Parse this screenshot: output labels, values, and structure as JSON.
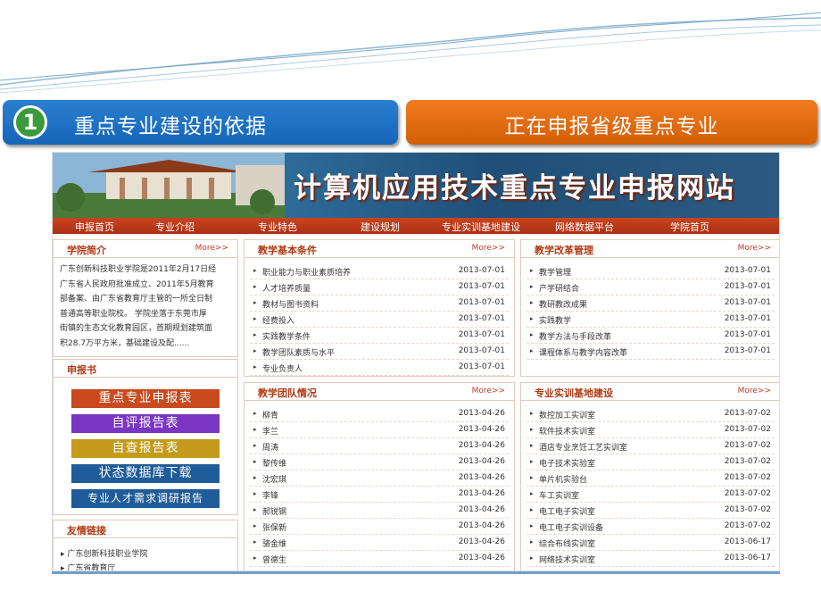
{
  "banner": {
    "num": "1",
    "left": "重点专业建设的依据",
    "right": "正在申报省级重点专业"
  },
  "site": {
    "title": "计算机应用技术重点专业申报网站",
    "nav": [
      "申报首页",
      "专业介绍",
      "专业特色",
      "建设规划",
      "专业实训基地建设",
      "网络数据平台",
      "学院首页"
    ],
    "more": "More>>",
    "intro": {
      "title": "学院简介",
      "lines": [
        "广东创新科技职业学院是2011年2月17日经",
        "广东省人民政府批准成立、2011年5月教育",
        "部备案、由广东省教育厅主管的一所全日制",
        "普通高等职业院校。 学院坐落于东莞市厚",
        "街镇的生态文化教育园区，首期规划建筑面",
        "积28.7万平方米，基础建设及配......"
      ]
    },
    "apply": {
      "title": "申报书",
      "buttons": [
        {
          "label": "重点专业申报表",
          "color": "#c84a1e"
        },
        {
          "label": "自评报告表",
          "color": "#7a35c3"
        },
        {
          "label": "自查报告表",
          "color": "#c39a1b"
        },
        {
          "label": "状态数据库下载",
          "color": "#1f5c99"
        },
        {
          "label": "专业人才需求调研报告",
          "color": "#1f5c99"
        }
      ]
    },
    "friends": {
      "title": "友情链接",
      "links": [
        "广东创新科技职业学院",
        "广东省教育厅"
      ]
    },
    "basics": {
      "title": "教学基本条件",
      "rows": [
        {
          "name": "职业能力与职业素质培养",
          "date": "2013-07-01"
        },
        {
          "name": "人才培养质量",
          "date": "2013-07-01"
        },
        {
          "name": "教材与图书资料",
          "date": "2013-07-01"
        },
        {
          "name": "经费投入",
          "date": "2013-07-01"
        },
        {
          "name": "实践教学条件",
          "date": "2013-07-01"
        },
        {
          "name": "教学团队素质与水平",
          "date": "2013-07-01"
        },
        {
          "name": "专业负责人",
          "date": "2013-07-01"
        }
      ]
    },
    "reform": {
      "title": "教学改革管理",
      "rows": [
        {
          "name": "教学管理",
          "date": "2013-07-01"
        },
        {
          "name": "产学研结合",
          "date": "2013-07-01"
        },
        {
          "name": "教研教改成果",
          "date": "2013-07-01"
        },
        {
          "name": "实践教学",
          "date": "2013-07-01"
        },
        {
          "name": "教学方法与手段改革",
          "date": "2013-07-01"
        },
        {
          "name": "课程体系与教学内容改革",
          "date": "2013-07-01"
        }
      ]
    },
    "team": {
      "title": "教学团队情况",
      "rows": [
        {
          "name": "柳青",
          "date": "2013-04-26"
        },
        {
          "name": "李兰",
          "date": "2013-04-26"
        },
        {
          "name": "周涛",
          "date": "2013-04-26"
        },
        {
          "name": "黎传维",
          "date": "2013-04-26"
        },
        {
          "name": "沈宏琪",
          "date": "2013-04-26"
        },
        {
          "name": "李锋",
          "date": "2013-04-26"
        },
        {
          "name": "郝锐钢",
          "date": "2013-04-26"
        },
        {
          "name": "张保新",
          "date": "2013-04-26"
        },
        {
          "name": "骆金维",
          "date": "2013-04-26"
        },
        {
          "name": "曾德生",
          "date": "2013-04-26"
        }
      ]
    },
    "base": {
      "title": "专业实训基地建设",
      "rows": [
        {
          "name": "数控加工实训室",
          "date": "2013-07-02"
        },
        {
          "name": "软件技术实训室",
          "date": "2013-07-02"
        },
        {
          "name": "酒店专业烹饪工艺实训室",
          "date": "2013-07-02"
        },
        {
          "name": "电子技术实验室",
          "date": "2013-07-02"
        },
        {
          "name": "单片机实验台",
          "date": "2013-07-02"
        },
        {
          "name": "车工实训室",
          "date": "2013-07-02"
        },
        {
          "name": "电工电子实训室",
          "date": "2013-07-02"
        },
        {
          "name": "电工电子实训设备",
          "date": "2013-07-02"
        },
        {
          "name": "综合布线实训室",
          "date": "2013-06-17"
        },
        {
          "name": "网络技术实训室",
          "date": "2013-06-17"
        }
      ]
    }
  }
}
